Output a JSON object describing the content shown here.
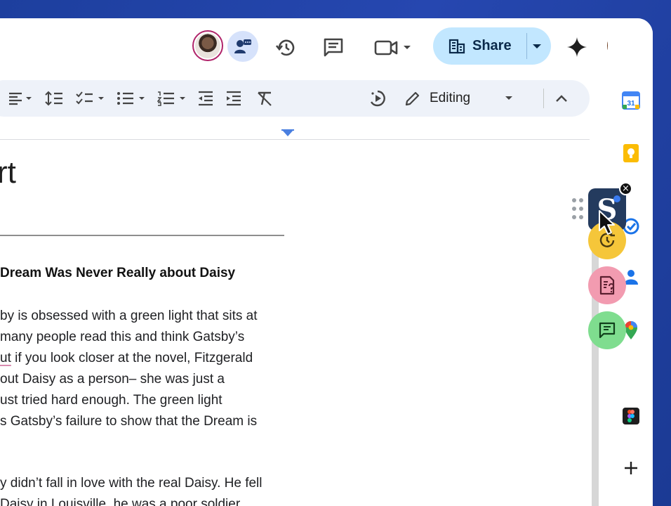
{
  "header": {
    "share_label": "Share",
    "icons": [
      "collaborator-avatar",
      "presence-chip",
      "version-history-icon",
      "comments-icon",
      "video-call-icon",
      "share-button",
      "gemini-sparkle-icon",
      "user-avatar"
    ]
  },
  "toolbar": {
    "mode_label": "Editing",
    "icons": [
      "align-left-icon",
      "line-spacing-icon",
      "checklist-icon",
      "bulleted-list-icon",
      "numbered-list-icon",
      "decrease-indent-icon",
      "increase-indent-icon",
      "clear-formatting-icon",
      "voice-typing-icon",
      "pencil-icon",
      "collapse-toolbar-icon"
    ]
  },
  "document": {
    "title_fragment": "rt",
    "heading": "Dream Was Never Really about Daisy",
    "para1": [
      "by is obsessed with a green light that sits at",
      "many people read this and think Gatsby’s",
      "if you look closer at the novel, Fitzgerald",
      "out Daisy as a person– she was just a",
      "ust tried hard enough. The green light",
      "s Gatsby’s failure to show that the Dream is"
    ],
    "para1_underlined_word": "ut",
    "para2": [
      "y didn’t fall in love with the real Daisy. He fell",
      "Daisy in Louisville, he was a poor soldier"
    ]
  },
  "side_panel": {
    "apps": [
      "calendar-icon",
      "keep-icon",
      "tasks-icon",
      "contacts-icon",
      "maps-icon",
      "figma-icon",
      "add-app-icon"
    ],
    "calendar_day": "31"
  },
  "floating_widget": {
    "logo_letter": "S",
    "buttons": [
      "history-clock-button",
      "document-question-button",
      "chat-button"
    ],
    "colors": {
      "logo_bg": "#243b5e",
      "history": "#f5c63a",
      "doc": "#f29bb0",
      "chat": "#7fdd8f"
    }
  },
  "colors": {
    "share_bg": "#c2e7ff",
    "toolbar_bg": "#eef2f9",
    "page_bg": "#1d3f9e"
  }
}
